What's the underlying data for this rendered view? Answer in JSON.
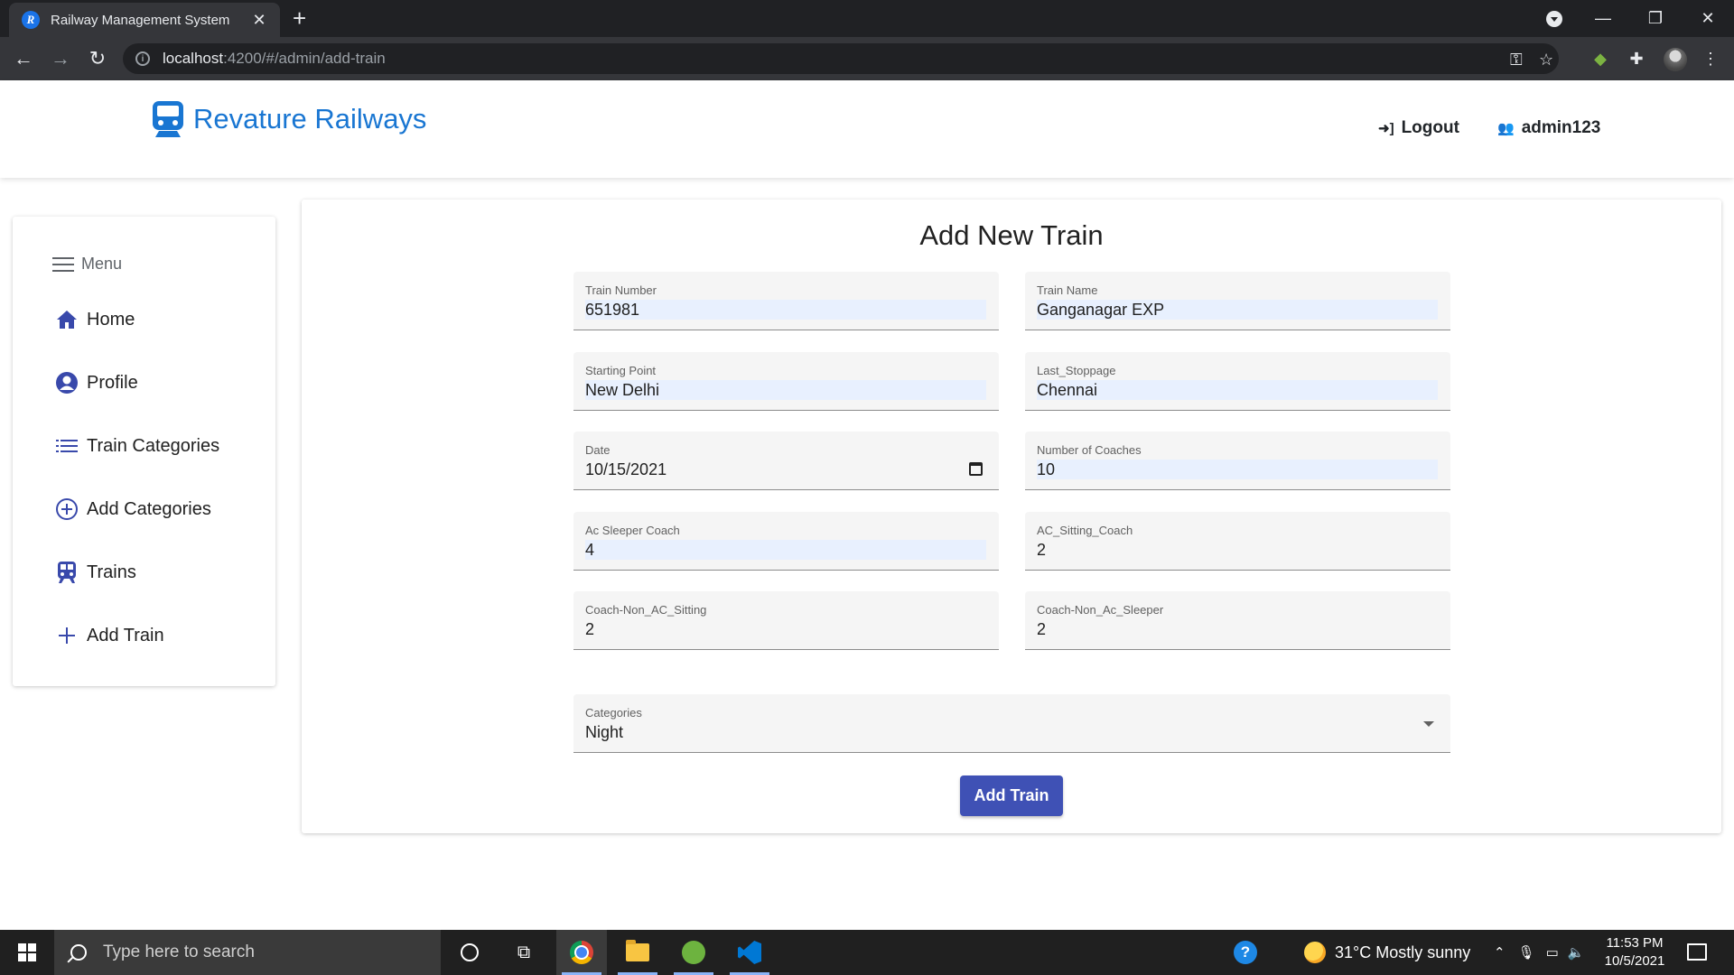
{
  "browser": {
    "tab_title": "Railway Management System",
    "url_host": "localhost",
    "url_rest": ":4200/#/admin/add-train"
  },
  "app": {
    "brand": "Revature Railways",
    "logout_label": "Logout",
    "user_label": "admin123"
  },
  "sidebar": {
    "menu_label": "Menu",
    "items": [
      {
        "label": "Home",
        "icon": "home-icon"
      },
      {
        "label": "Profile",
        "icon": "account-circle-icon"
      },
      {
        "label": "Train Categories",
        "icon": "list-icon"
      },
      {
        "label": "Add Categories",
        "icon": "add-circle-icon"
      },
      {
        "label": "Trains",
        "icon": "train-icon"
      },
      {
        "label": "Add Train",
        "icon": "plus-icon"
      }
    ]
  },
  "form": {
    "title": "Add New Train",
    "train_number": {
      "label": "Train Number",
      "value": "651981"
    },
    "train_name": {
      "label": "Train Name",
      "value": "Ganganagar EXP"
    },
    "starting_point": {
      "label": "Starting Point",
      "value": "New Delhi"
    },
    "last_stoppage": {
      "label": "Last_Stoppage",
      "value": "Chennai"
    },
    "date": {
      "label": "Date",
      "value": "10/15/2021"
    },
    "number_of_coaches": {
      "label": "Number of Coaches",
      "value": "10"
    },
    "ac_sleeper": {
      "label": "Ac Sleeper Coach",
      "value": "4"
    },
    "ac_sitting": {
      "label": "AC_Sitting_Coach",
      "value": "2"
    },
    "non_ac_sitting": {
      "label": "Coach-Non_AC_Sitting",
      "value": "2"
    },
    "non_ac_sleeper": {
      "label": "Coach-Non_Ac_Sleeper",
      "value": "2"
    },
    "categories": {
      "label": "Categories",
      "value": "Night"
    },
    "submit_label": "Add Train"
  },
  "taskbar": {
    "search_placeholder": "Type here to search",
    "weather": "31°C  Mostly sunny",
    "time": "11:53 PM",
    "date": "10/5/2021"
  },
  "colors": {
    "brand": "#1976d2",
    "primary_button": "#3f51b5",
    "sidebar_icon": "#3949ab"
  }
}
